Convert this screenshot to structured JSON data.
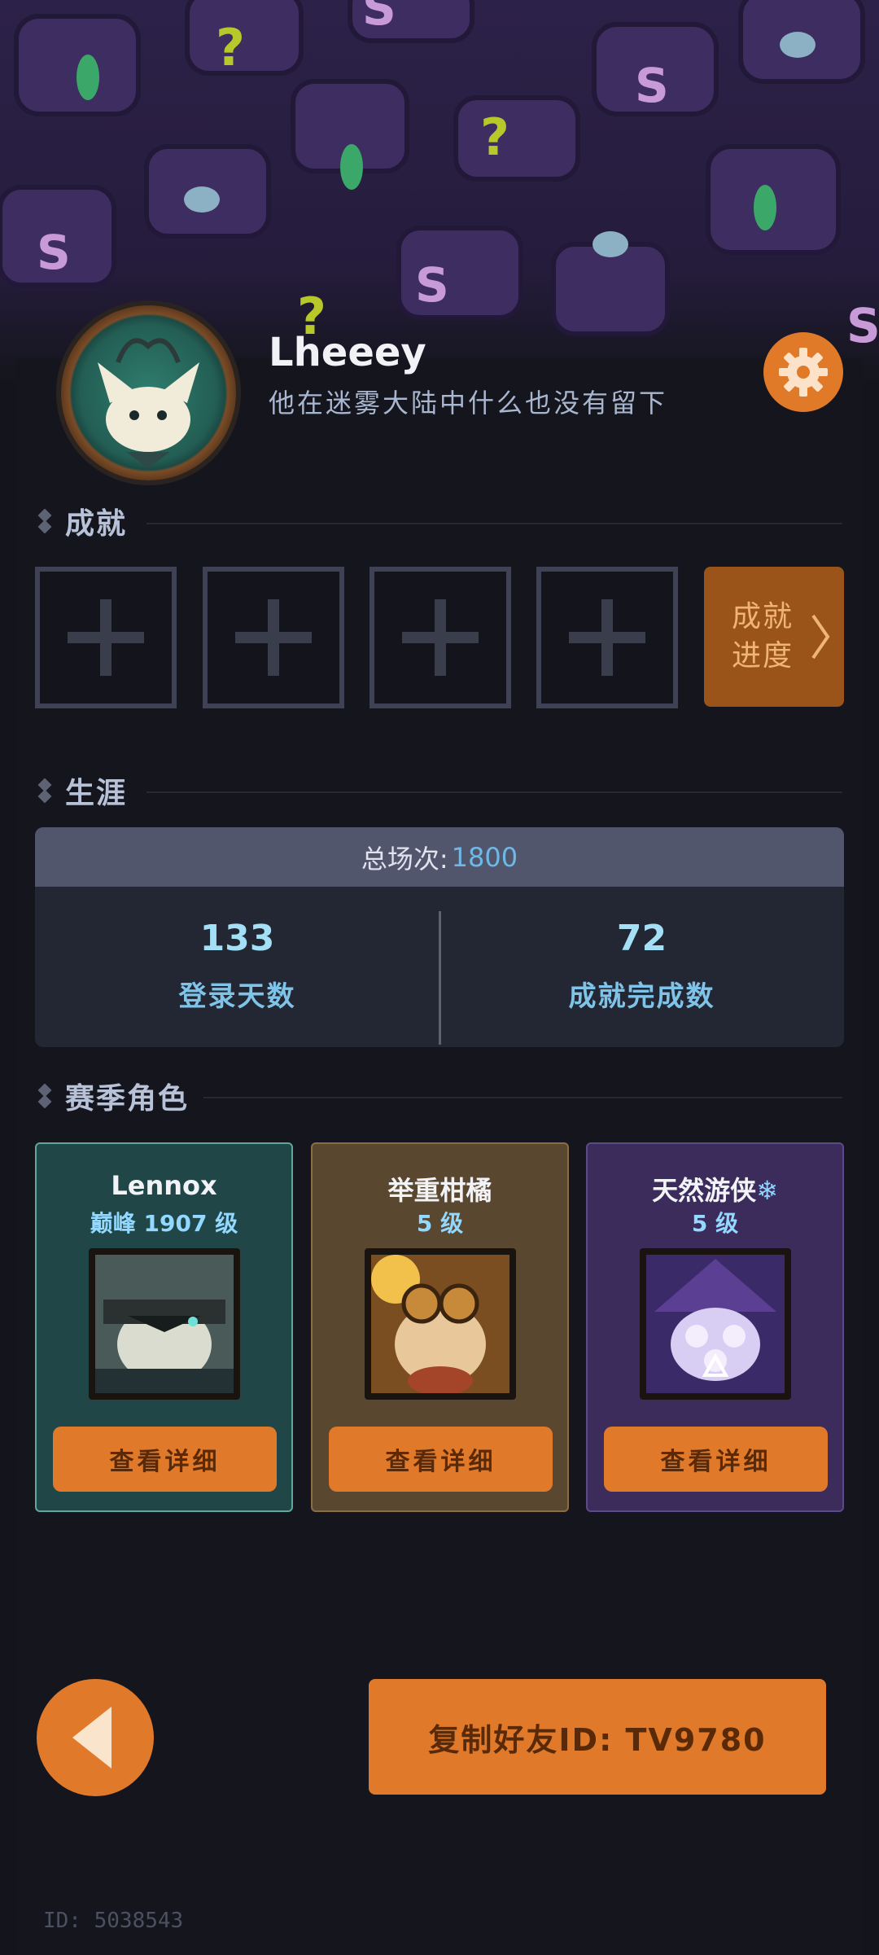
{
  "profile": {
    "username": "Lheeey",
    "motto": "他在迷雾大陆中什么也没有留下"
  },
  "sections": {
    "achievements": "成就",
    "career": "生涯",
    "season_roles": "赛季角色"
  },
  "achievements": {
    "progress_line1": "成就",
    "progress_line2": "进度"
  },
  "career": {
    "total_label": "总场次:",
    "total_value": "1800",
    "login_days_value": "133",
    "login_days_label": "登录天数",
    "achievements_done_value": "72",
    "achievements_done_label": "成就完成数"
  },
  "characters": [
    {
      "name": "Lennox",
      "level": "巅峰 1907 级",
      "button": "查看详细"
    },
    {
      "name": "举重柑橘",
      "level": "5 级",
      "button": "查看详细"
    },
    {
      "name": "天然游侠",
      "name_suffix": "❄",
      "level": "5 级",
      "button": "查看详细"
    }
  ],
  "footer": {
    "copy_button": "复制好友ID: TV9780",
    "id_text": "ID: 5038543"
  },
  "colors": {
    "accent_orange": "#e07a2a",
    "career_value_blue": "#6fb8e6",
    "background": "#14151c"
  },
  "icons": [
    "gear-icon",
    "diamond-icon",
    "plus-icon",
    "chevron-right-icon",
    "back-arrow-icon",
    "snowflake-icon"
  ]
}
